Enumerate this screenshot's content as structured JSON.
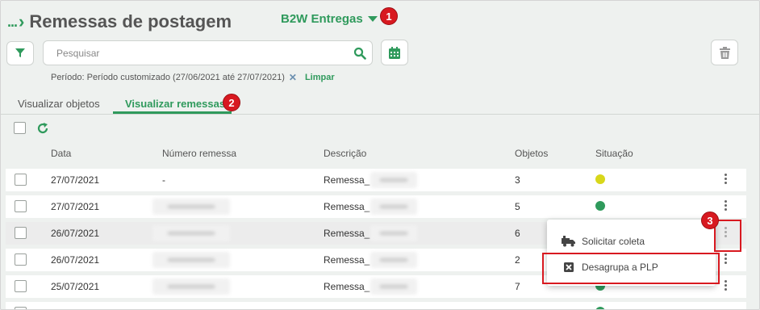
{
  "header": {
    "breadcrumb": "...",
    "title": "Remessas de postagem",
    "company": "B2W Entregas"
  },
  "search": {
    "placeholder": "Pesquisar"
  },
  "filter": {
    "period_text": "Período: Período customizado (27/06/2021 até 27/07/2021)",
    "clear_label": "Limpar"
  },
  "tabs": [
    {
      "label": "Visualizar objetos"
    },
    {
      "label": "Visualizar remessas"
    }
  ],
  "table": {
    "columns": [
      "Data",
      "Número remessa",
      "Descrição",
      "Objetos",
      "Situação"
    ],
    "rows": [
      {
        "date": "27/07/2021",
        "number": "-",
        "description": "Remessa_",
        "objects": "3",
        "status_color": "#d8d71a"
      },
      {
        "date": "27/07/2021",
        "number": "",
        "description": "Remessa_",
        "objects": "5",
        "status_color": "#2f9a5c"
      },
      {
        "date": "26/07/2021",
        "number": "",
        "description": "Remessa_",
        "objects": "6",
        "status_color": "#2f9a5c"
      },
      {
        "date": "26/07/2021",
        "number": "",
        "description": "Remessa_",
        "objects": "2",
        "status_color": "#2f9a5c"
      },
      {
        "date": "25/07/2021",
        "number": "",
        "description": "Remessa_",
        "objects": "7",
        "status_color": "#2f9a5c"
      }
    ]
  },
  "context_menu": {
    "items": [
      {
        "label": "Solicitar coleta",
        "icon": "truck-icon"
      },
      {
        "label": "Desagrupa a PLP",
        "icon": "close-box-icon"
      }
    ]
  },
  "annotations": [
    "1",
    "2",
    "3"
  ],
  "colors": {
    "accent": "#2f9a5c",
    "annotation": "#d81920"
  }
}
